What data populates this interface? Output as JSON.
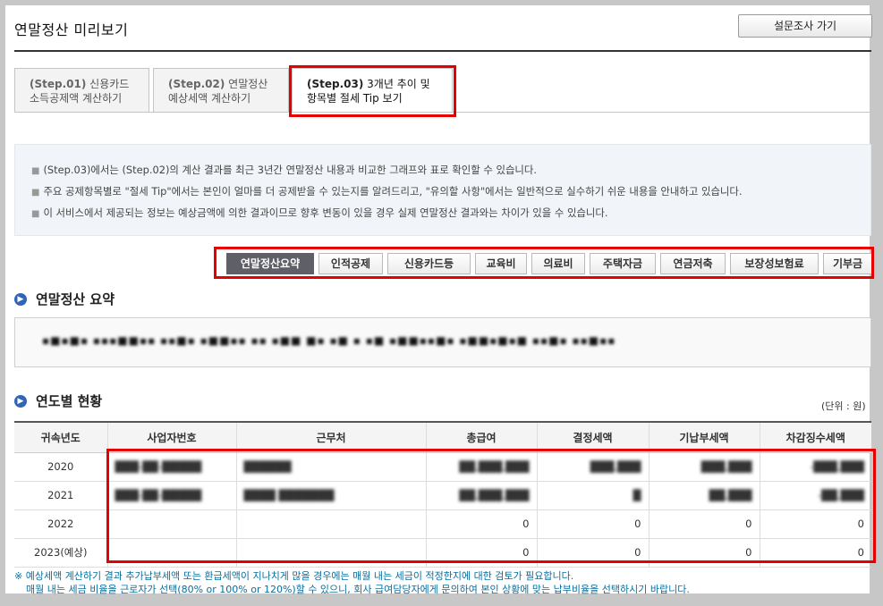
{
  "page": {
    "title": "연말정산 미리보기",
    "survey_button": "설문조사 가기"
  },
  "step_tabs": [
    {
      "step": "(Step.01)",
      "line1": "신용카드",
      "line2": "소득공제액 계산하기",
      "active": false
    },
    {
      "step": "(Step.02)",
      "line1": "연말정산",
      "line2": "예상세액 계산하기",
      "active": false
    },
    {
      "step": "(Step.03)",
      "line1": "3개년 추이 및",
      "line2": "항목별 절세 Tip 보기",
      "active": true
    }
  ],
  "info": {
    "lines": [
      "(Step.03)에서는 (Step.02)의 계산 결과를 최근 3년간 연말정산 내용과 비교한 그래프와 표로 확인할 수 있습니다.",
      "주요 공제항목별로 \"절세 Tip\"에서는 본인이 얼마를 더 공제받을 수 있는지를 알려드리고, \"유의할 사항\"에서는 일반적으로 실수하기 쉬운 내용을 안내하고 있습니다.",
      "이 서비스에서 제공되는 정보는 예상금액에 의한 결과이므로 향후 변동이 있을 경우 실제 연말정산 결과와는 차이가 있을 수 있습니다."
    ]
  },
  "sub_tabs": [
    {
      "label": "연말정산요약",
      "active": true
    },
    {
      "label": "인적공제",
      "active": false
    },
    {
      "label": "신용카드등",
      "active": false
    },
    {
      "label": "교육비",
      "active": false
    },
    {
      "label": "의료비",
      "active": false
    },
    {
      "label": "주택자금",
      "active": false
    },
    {
      "label": "연금저축",
      "active": false
    },
    {
      "label": "보장성보험료",
      "active": false
    },
    {
      "label": "기부금",
      "active": false
    }
  ],
  "summary": {
    "heading": "연말정산 요약",
    "text": "▪■▪■▪  ▪▪▪■■▪▪  ▪▪■▪ ▪■■▪▪ ▪▪ ▪■■ ■▪ ▪■ ▪ ▪■ ▪■■▪▪■▪ ▪■■▪■▪■ ▪▪■▪ ▪▪■▪▪"
  },
  "yearly": {
    "heading": "연도별 현황",
    "unit": "(단위 : 원)",
    "columns": [
      "귀속년도",
      "사업자번호",
      "근무처",
      "총급여",
      "결정세액",
      "기납부세액",
      "차감징수세액"
    ],
    "rows": [
      {
        "year": "2020",
        "biz_no": "███-██-█████",
        "company": "██████",
        "total_pay": "██,███,███",
        "decided_tax": "███,███",
        "prepaid_tax": "███,███",
        "net_tax": "-███,███",
        "blurred": true
      },
      {
        "year": "2021",
        "biz_no": "███-██-█████",
        "company": "████ ███████",
        "total_pay": "██,███,███",
        "decided_tax": "█",
        "prepaid_tax": "██,███",
        "net_tax": "-██,███",
        "blurred": true
      },
      {
        "year": "2022",
        "biz_no": "",
        "company": "",
        "total_pay": "0",
        "decided_tax": "0",
        "prepaid_tax": "0",
        "net_tax": "0",
        "blurred": false
      },
      {
        "year": "2023(예상)",
        "biz_no": "",
        "company": "",
        "total_pay": "0",
        "decided_tax": "0",
        "prepaid_tax": "0",
        "net_tax": "0",
        "blurred": false
      }
    ]
  },
  "notes": [
    "※ 예상세액 계산하기 결과 추가납부세액 또는 환급세액이 지나치게 많을 경우에는 매월 내는 세금이 적정한지에 대한 검토가 필요합니다.",
    "매월 내는 세금 비율을 근로자가 선택(80% or 100% or 120%)할 수 있으니, 회사 급여담당자에게 문의하여 본인 상황에 맞는 납부비율을 선택하시기 바랍니다."
  ],
  "colors": {
    "highlight": "#e60000",
    "active_subtab": "#5f5f67",
    "section_icon": "#2f66b8",
    "note_text": "#0a6e9e"
  }
}
